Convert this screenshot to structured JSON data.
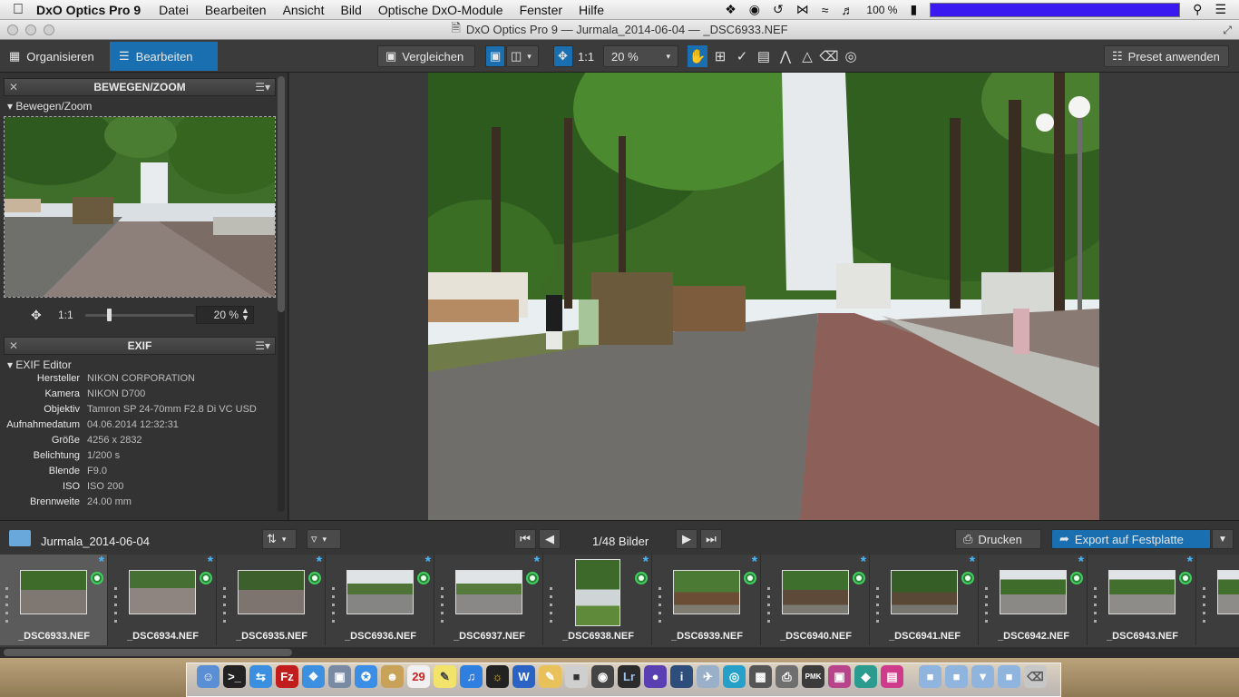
{
  "menubar": {
    "app_name": "DxO Optics Pro 9",
    "menus": [
      "Datei",
      "Bearbeiten",
      "Ansicht",
      "Bild",
      "Optische DxO-Module",
      "Fenster",
      "Hilfe"
    ],
    "battery": "100 %"
  },
  "window": {
    "title": "DxO Optics Pro 9 — Jurmala_2014-06-04 — _DSC6933.NEF"
  },
  "toolbar": {
    "tab_organize": "Organisieren",
    "tab_edit": "Bearbeiten",
    "compare": "Vergleichen",
    "ratio": "1:1",
    "zoom_value": "20 %",
    "preset": "Preset anwenden"
  },
  "move_zoom_panel": {
    "title": "BEWEGEN/ZOOM",
    "subtitle": "Bewegen/Zoom",
    "ratio": "1:1",
    "zoom": "20 %"
  },
  "exif_panel": {
    "title": "EXIF",
    "subtitle": "EXIF Editor",
    "rows": [
      {
        "key": "Hersteller",
        "value": "NIKON CORPORATION"
      },
      {
        "key": "Kamera",
        "value": "NIKON D700"
      },
      {
        "key": "Objektiv",
        "value": "Tamron SP 24-70mm F2.8 Di VC USD"
      },
      {
        "key": "Aufnahmedatum",
        "value": "04.06.2014 12:32:31"
      },
      {
        "key": "Größe",
        "value": "4256 x 2832"
      },
      {
        "key": "Belichtung",
        "value": "1/200 s"
      },
      {
        "key": "Blende",
        "value": "F9.0"
      },
      {
        "key": "ISO",
        "value": "ISO 200"
      },
      {
        "key": "Brennweite",
        "value": "24.00 mm"
      }
    ]
  },
  "filmstrip": {
    "folder": "Jurmala_2014-06-04",
    "counter": "1/48 Bilder",
    "print": "Drucken",
    "export": "Export auf Festplatte",
    "thumbnails": [
      "_DSC6933.NEF",
      "_DSC6934.NEF",
      "_DSC6935.NEF",
      "_DSC6936.NEF",
      "_DSC6937.NEF",
      "_DSC6938.NEF",
      "_DSC6939.NEF",
      "_DSC6940.NEF",
      "_DSC6941.NEF",
      "_DSC6942.NEF",
      "_DSC6943.NEF"
    ]
  },
  "dock": {
    "calendar_day": "29"
  },
  "colors": {
    "accent_blue": "#1a6fb1",
    "status_green": "#3ecf5a",
    "star_blue": "#4ab8ff"
  }
}
